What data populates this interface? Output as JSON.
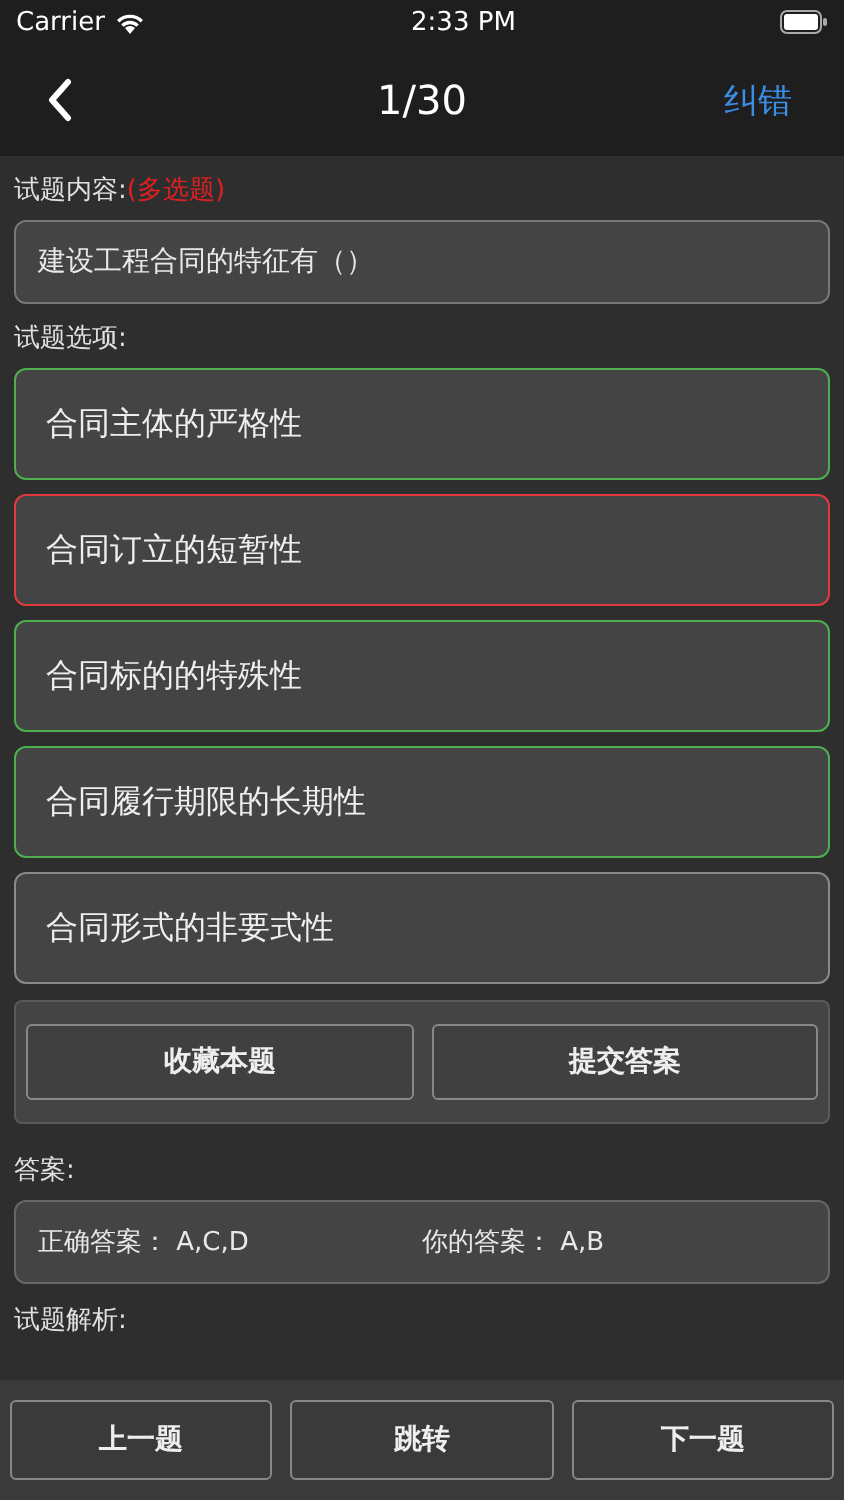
{
  "status_bar": {
    "carrier": "Carrier",
    "time": "2:33 PM"
  },
  "nav": {
    "title": "1/30",
    "action": "纠错"
  },
  "question": {
    "label": "试题内容:",
    "type": "(多选题)",
    "text": "建设工程合同的特征有（）"
  },
  "options_label": "试题选项:",
  "options": [
    {
      "text": "合同主体的严格性",
      "color": "#4caf50"
    },
    {
      "text": "合同订立的短暂性",
      "color": "#e0393e"
    },
    {
      "text": "合同标的的特殊性",
      "color": "#4caf50"
    },
    {
      "text": "合同履行期限的长期性",
      "color": "#4caf50"
    },
    {
      "text": "合同形式的非要式性",
      "color": "#8a8a8a"
    }
  ],
  "actions": [
    "收藏本题",
    "提交答案"
  ],
  "answer": {
    "label": "答案:",
    "correct_label": "正确答案：",
    "correct": "A,C,D",
    "yours_label": "你的答案：",
    "yours": "A,B"
  },
  "analysis_label": "试题解析:",
  "bottom_buttons": [
    "上一题",
    "跳转",
    "下一题"
  ]
}
